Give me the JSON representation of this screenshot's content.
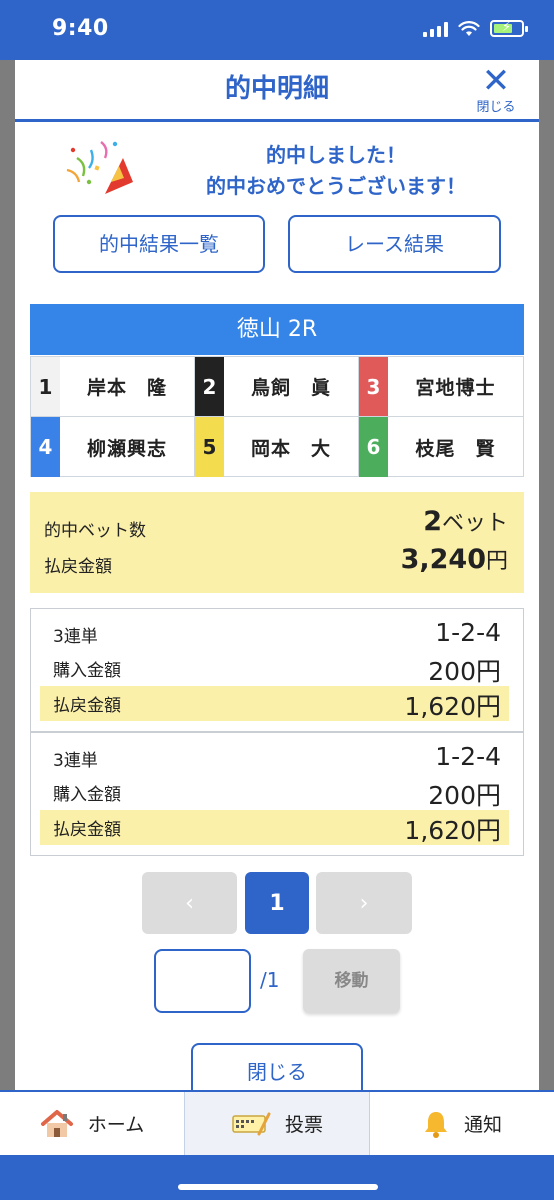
{
  "status": {
    "time": "9:40"
  },
  "modal": {
    "title": "的中明細",
    "close_label": "閉じる",
    "congrats_line1": "的中しました！",
    "congrats_line2": "的中おめでとうございます！",
    "btn_hit_list": "的中結果一覧",
    "btn_race_result": "レース結果"
  },
  "race": {
    "title": "徳山 2R",
    "racers": [
      {
        "num": "1",
        "name": "岸本　隆",
        "bg": "#f2f2f2",
        "fg": "#222222"
      },
      {
        "num": "2",
        "name": "鳥飼　眞",
        "bg": "#222222",
        "fg": "#ffffff"
      },
      {
        "num": "3",
        "name": "宮地博士",
        "bg": "#e05a5a",
        "fg": "#ffffff"
      },
      {
        "num": "4",
        "name": "柳瀬興志",
        "bg": "#3b82e8",
        "fg": "#ffffff"
      },
      {
        "num": "5",
        "name": "岡本　大",
        "bg": "#f3dc4e",
        "fg": "#222222"
      },
      {
        "num": "6",
        "name": "枝尾　賢",
        "bg": "#4cae5c",
        "fg": "#ffffff"
      }
    ]
  },
  "summary": {
    "bet_count_label": "的中ベット数",
    "bet_count_value": "2",
    "bet_count_unit": "ベット",
    "payout_label": "払戻金額",
    "payout_value": "3,240",
    "payout_unit": "円"
  },
  "bets": [
    {
      "type": "3連単",
      "combo": "1-2-4",
      "purchase_label": "購入金額",
      "purchase": "200円",
      "payout_label": "払戻金額",
      "payout": "1,620円"
    },
    {
      "type": "3連単",
      "combo": "1-2-4",
      "purchase_label": "購入金額",
      "purchase": "200円",
      "payout_label": "払戻金額",
      "payout": "1,620円"
    }
  ],
  "pager": {
    "prev": "‹",
    "current": "1",
    "next": "›",
    "input_value": "",
    "total": "/1",
    "move_label": "移動"
  },
  "close_bottom": "閉じる",
  "tabs": [
    {
      "label": "ホーム",
      "icon": "house-icon"
    },
    {
      "label": "投票",
      "icon": "ticket-icon"
    },
    {
      "label": "通知",
      "icon": "bell-icon"
    }
  ],
  "colors": {
    "accent": "#2f65c8",
    "race_header": "#3585e8",
    "highlight": "#fbf0aa"
  }
}
